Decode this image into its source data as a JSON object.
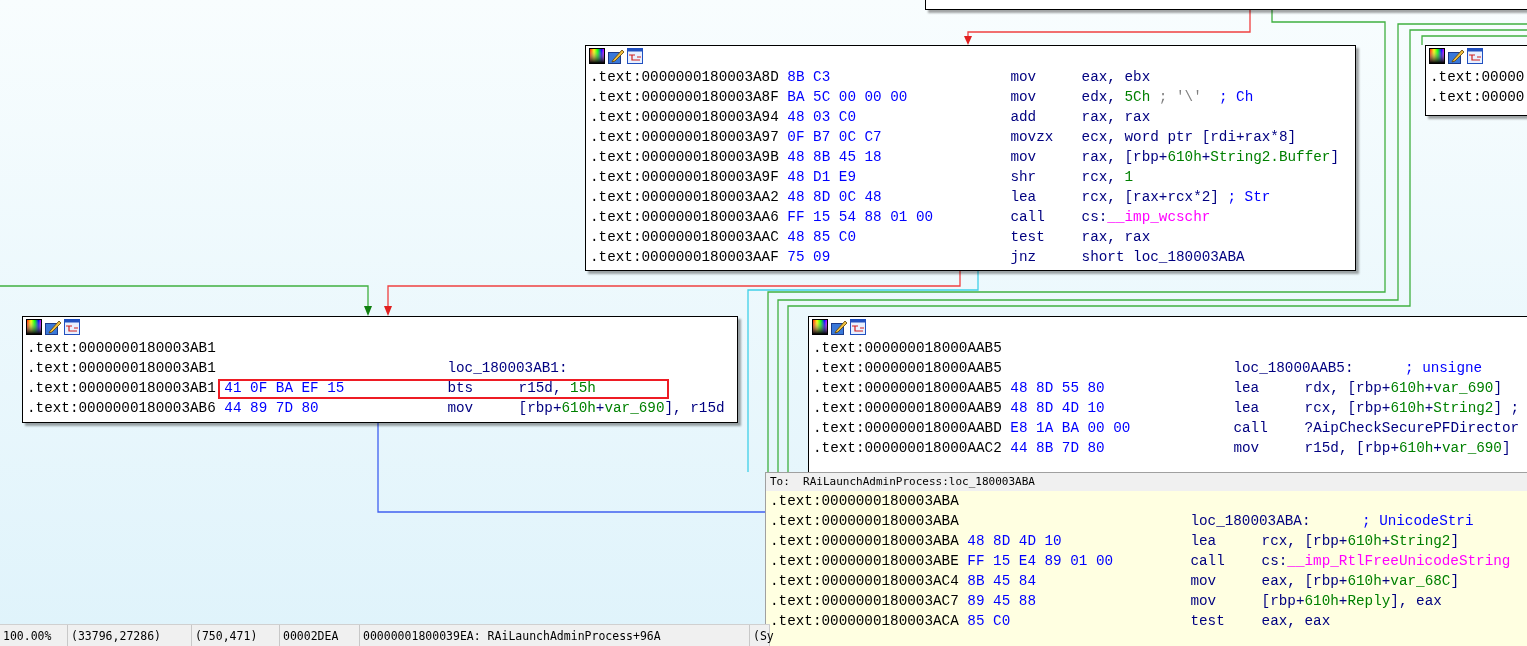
{
  "nodes": [
    {
      "toolbar": false
    },
    {
      "toolbar": true,
      "lines": [
        {
          "kind": "code",
          "address": ".text:0000000180003A8D",
          "bytes": "8B C3",
          "mnemonic": "mov",
          "operands": [
            {
              "text": "eax, ebx",
              "kind": "plain"
            }
          ]
        },
        {
          "kind": "code",
          "address": ".text:0000000180003A8F",
          "bytes": "BA 5C 00 00 00",
          "mnemonic": "mov",
          "operands": [
            {
              "text": "edx, ",
              "kind": "plain"
            },
            {
              "text": "5Ch",
              "kind": "number"
            },
            {
              "text": " ; '\\'",
              "kind": "string"
            },
            {
              "text": "  ; Ch",
              "kind": "comment"
            }
          ]
        },
        {
          "kind": "code",
          "address": ".text:0000000180003A94",
          "bytes": "48 03 C0",
          "mnemonic": "add",
          "operands": [
            {
              "text": "rax, rax",
              "kind": "plain"
            }
          ]
        },
        {
          "kind": "code",
          "address": ".text:0000000180003A97",
          "bytes": "0F B7 0C C7",
          "mnemonic": "movzx",
          "operands": [
            {
              "text": "ecx, word ptr [rdi+rax*8]",
              "kind": "plain"
            }
          ]
        },
        {
          "kind": "code",
          "address": ".text:0000000180003A9B",
          "bytes": "48 8B 45 18",
          "mnemonic": "mov",
          "operands": [
            {
              "text": "rax, [rbp+",
              "kind": "plain"
            },
            {
              "text": "610h",
              "kind": "number"
            },
            {
              "text": "+",
              "kind": "plain"
            },
            {
              "text": "String2.Buffer",
              "kind": "number"
            },
            {
              "text": "]",
              "kind": "plain"
            }
          ]
        },
        {
          "kind": "code",
          "address": ".text:0000000180003A9F",
          "bytes": "48 D1 E9",
          "mnemonic": "shr",
          "operands": [
            {
              "text": "rcx, ",
              "kind": "plain"
            },
            {
              "text": "1",
              "kind": "number"
            }
          ]
        },
        {
          "kind": "code",
          "address": ".text:0000000180003AA2",
          "bytes": "48 8D 0C 48",
          "mnemonic": "lea",
          "operands": [
            {
              "text": "rcx, [rax+rcx*2]",
              "kind": "plain"
            },
            {
              "text": " ; Str",
              "kind": "comment"
            }
          ]
        },
        {
          "kind": "code",
          "address": ".text:0000000180003AA6",
          "bytes": "FF 15 54 88 01 00",
          "mnemonic": "call",
          "operands": [
            {
              "text": "cs:",
              "kind": "plain"
            },
            {
              "text": "__imp_wcschr",
              "kind": "import"
            }
          ]
        },
        {
          "kind": "code",
          "address": ".text:0000000180003AAC",
          "bytes": "48 85 C0",
          "mnemonic": "test",
          "operands": [
            {
              "text": "rax, rax",
              "kind": "plain"
            }
          ]
        },
        {
          "kind": "code",
          "address": ".text:0000000180003AAF",
          "bytes": "75 09",
          "mnemonic": "jnz",
          "operands": [
            {
              "text": "short loc_180003ABA",
              "kind": "plain"
            }
          ]
        }
      ]
    },
    {
      "toolbar": true,
      "lines": [
        {
          "kind": "address",
          "address": ".text:00000"
        },
        {
          "kind": "address",
          "address": ".text:00000"
        }
      ]
    },
    {
      "toolbar": true,
      "lines": [
        {
          "kind": "address",
          "address": ".text:0000000180003AB1"
        },
        {
          "kind": "label",
          "address": ".text:0000000180003AB1",
          "label": "loc_180003AB1:"
        },
        {
          "kind": "code",
          "highlighted": true,
          "address": ".text:0000000180003AB1",
          "bytes": "41 0F BA EF 15",
          "mnemonic": "bts",
          "operands": [
            {
              "text": "r15d, ",
              "kind": "plain"
            },
            {
              "text": "15h",
              "kind": "number"
            }
          ]
        },
        {
          "kind": "code",
          "highlighted": false,
          "address": ".text:0000000180003AB6",
          "bytes": "44 89 7D 80",
          "mnemonic": "mov",
          "operands": [
            {
              "text": "[rbp+",
              "kind": "plain"
            },
            {
              "text": "610h",
              "kind": "number"
            },
            {
              "text": "+",
              "kind": "plain"
            },
            {
              "text": "var_690",
              "kind": "number"
            },
            {
              "text": "], r15d",
              "kind": "plain"
            }
          ]
        }
      ]
    },
    {
      "toolbar": true,
      "lines": [
        {
          "kind": "address",
          "address": ".text:000000018000AAB5"
        },
        {
          "kind": "label",
          "address": ".text:000000018000AAB5",
          "label": "loc_18000AAB5:",
          "comment": "; unsigne"
        },
        {
          "kind": "code",
          "address": ".text:000000018000AAB5",
          "bytes": "48 8D 55 80",
          "mnemonic": "lea",
          "operands": [
            {
              "text": "rdx, [rbp+",
              "kind": "plain"
            },
            {
              "text": "610h",
              "kind": "number"
            },
            {
              "text": "+",
              "kind": "plain"
            },
            {
              "text": "var_690",
              "kind": "number"
            },
            {
              "text": "]",
              "kind": "plain"
            }
          ]
        },
        {
          "kind": "code",
          "address": ".text:000000018000AAB9",
          "bytes": "48 8D 4D 10",
          "mnemonic": "lea",
          "operands": [
            {
              "text": "rcx, [rbp+",
              "kind": "plain"
            },
            {
              "text": "610h",
              "kind": "number"
            },
            {
              "text": "+",
              "kind": "plain"
            },
            {
              "text": "String2",
              "kind": "number"
            },
            {
              "text": "] ;",
              "kind": "plain"
            }
          ]
        },
        {
          "kind": "code",
          "address": ".text:000000018000AABD",
          "bytes": "E8 1A BA 00 00",
          "mnemonic": "call",
          "operands": [
            {
              "text": "?AipCheckSecurePFDirector",
              "kind": "plain"
            }
          ]
        },
        {
          "kind": "code",
          "address": ".text:000000018000AAC2",
          "bytes": "44 8B 7D 80",
          "mnemonic": "mov",
          "operands": [
            {
              "text": "r15d, [rbp+",
              "kind": "plain"
            },
            {
              "text": "610h",
              "kind": "number"
            },
            {
              "text": "+",
              "kind": "plain"
            },
            {
              "text": "var_690",
              "kind": "number"
            },
            {
              "text": "]",
              "kind": "plain"
            }
          ]
        }
      ]
    }
  ],
  "tooltip": {
    "title": "To:  RAiLaunchAdminProcess:loc_180003ABA",
    "lines": [
      {
        "kind": "address",
        "address": ".text:0000000180003ABA"
      },
      {
        "kind": "label",
        "address": ".text:0000000180003ABA",
        "label": "loc_180003ABA:",
        "comment": "; UnicodeStri"
      },
      {
        "kind": "code",
        "address": ".text:0000000180003ABA",
        "bytes": "48 8D 4D 10",
        "mnemonic": "lea",
        "operands": [
          {
            "text": "rcx, [rbp+",
            "kind": "plain"
          },
          {
            "text": "610h",
            "kind": "number"
          },
          {
            "text": "+",
            "kind": "plain"
          },
          {
            "text": "String2",
            "kind": "number"
          },
          {
            "text": "]",
            "kind": "plain"
          }
        ]
      },
      {
        "kind": "code",
        "address": ".text:0000000180003ABE",
        "bytes": "FF 15 E4 89 01 00",
        "mnemonic": "call",
        "operands": [
          {
            "text": "cs:",
            "kind": "plain"
          },
          {
            "text": "__imp_RtlFreeUnicodeString",
            "kind": "import"
          }
        ]
      },
      {
        "kind": "code",
        "address": ".text:0000000180003AC4",
        "bytes": "8B 45 84",
        "mnemonic": "mov",
        "operands": [
          {
            "text": "eax, [rbp+",
            "kind": "plain"
          },
          {
            "text": "610h",
            "kind": "number"
          },
          {
            "text": "+",
            "kind": "plain"
          },
          {
            "text": "var_68C",
            "kind": "number"
          },
          {
            "text": "]",
            "kind": "plain"
          }
        ]
      },
      {
        "kind": "code",
        "address": ".text:0000000180003AC7",
        "bytes": "89 45 88",
        "mnemonic": "mov",
        "operands": [
          {
            "text": "[rbp+",
            "kind": "plain"
          },
          {
            "text": "610h",
            "kind": "number"
          },
          {
            "text": "+",
            "kind": "plain"
          },
          {
            "text": "Reply",
            "kind": "number"
          },
          {
            "text": "], eax",
            "kind": "plain"
          }
        ]
      },
      {
        "kind": "code",
        "address": ".text:0000000180003ACA",
        "bytes": "85 C0",
        "mnemonic": "test",
        "operands": [
          {
            "text": "eax, eax",
            "kind": "plain"
          }
        ]
      }
    ]
  },
  "status_bar": [
    "100.00%",
    "(33796,27286)",
    "(750,471)",
    "00002DEA",
    "00000001800039EA: RAiLaunchAdminProcess+96A",
    "(Sy"
  ]
}
